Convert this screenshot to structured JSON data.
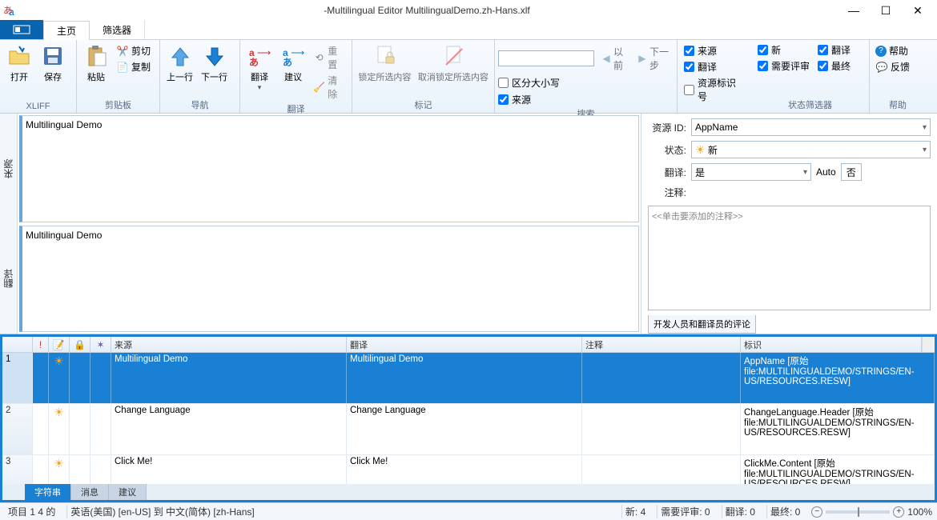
{
  "window": {
    "title": "-Multilingual Editor MultilingualDemo.zh-Hans.xlf"
  },
  "tabs": {
    "file_icon": "▭",
    "home": "主页",
    "filter": "筛选器"
  },
  "ribbon": {
    "xliff": {
      "open": "打开",
      "save": "保存",
      "group": "XLIFF"
    },
    "clipboard": {
      "paste": "粘贴",
      "cut": "剪切",
      "copy": "复制",
      "group": "剪贴板"
    },
    "nav": {
      "prev": "上一行",
      "next": "下一行",
      "group": "导航"
    },
    "translate": {
      "translate": "翻译",
      "suggest": "建议",
      "reset": "重置",
      "clear": "清除",
      "group": "翻译"
    },
    "selection": {
      "lock": "锁定所选内容",
      "unlock": "取消锁定所选内容",
      "group": "标记"
    },
    "search": {
      "prev": "以前",
      "next": "下一步",
      "case": "区分大小写",
      "group": "搜索"
    },
    "source_filter": {
      "source": "来源",
      "translation": "翻译",
      "resid": "资源标识号"
    },
    "state_filter": {
      "new": "新",
      "review": "需要评审",
      "trans": "翻译",
      "final": "最终",
      "group": "状态筛选器"
    },
    "help": {
      "help": "帮助",
      "feedback": "反馈",
      "group": "帮助"
    }
  },
  "panes": {
    "source_label": "来源",
    "target_label": "翻译",
    "source_text": "Multilingual Demo",
    "target_text": "Multilingual Demo"
  },
  "props": {
    "resid_label": "资源 ID:",
    "resid_value": "AppName",
    "state_label": "状态:",
    "state_value": "新",
    "trans_label": "翻译:",
    "trans_value": "是",
    "auto_label": "Auto",
    "auto_value": "否",
    "comment_label": "注释:",
    "comment_placeholder": "<<单击要添加的注释>>",
    "comments_tab": "开发人员和翻译员的评论"
  },
  "grid": {
    "headers": {
      "source": "来源",
      "translation": "翻译",
      "comment": "注释",
      "id": "标识"
    },
    "rows": [
      {
        "n": "1",
        "source": "Multilingual Demo",
        "translation": "Multilingual Demo",
        "comment": "",
        "id": "AppName [原始 file:MULTILINGUALDEMO/STRINGS/EN-US/RESOURCES.RESW]",
        "selected": true
      },
      {
        "n": "2",
        "source": "Change Language",
        "translation": "Change Language",
        "comment": "",
        "id": "ChangeLanguage.Header [原始 file:MULTILINGUALDEMO/STRINGS/EN-US/RESOURCES.RESW]",
        "selected": false
      },
      {
        "n": "3",
        "source": "Click Me!",
        "translation": "Click Me!",
        "comment": "",
        "id": "ClickMe.Content [原始 file:MULTILINGUALDEMO/STRINGS/EN-US/RESOURCES.RESW]",
        "selected": false
      }
    ]
  },
  "bottom_tabs": {
    "strings": "字符串",
    "messages": "消息",
    "suggestions": "建议"
  },
  "status": {
    "items": "项目 1 4 的",
    "langs": "英语(美国) [en-US] 到 中文(简体) [zh-Hans]",
    "new": "新: 4",
    "review": "需要评审: 0",
    "trans": "翻译: 0",
    "final": "最终: 0",
    "zoom": "100%"
  }
}
